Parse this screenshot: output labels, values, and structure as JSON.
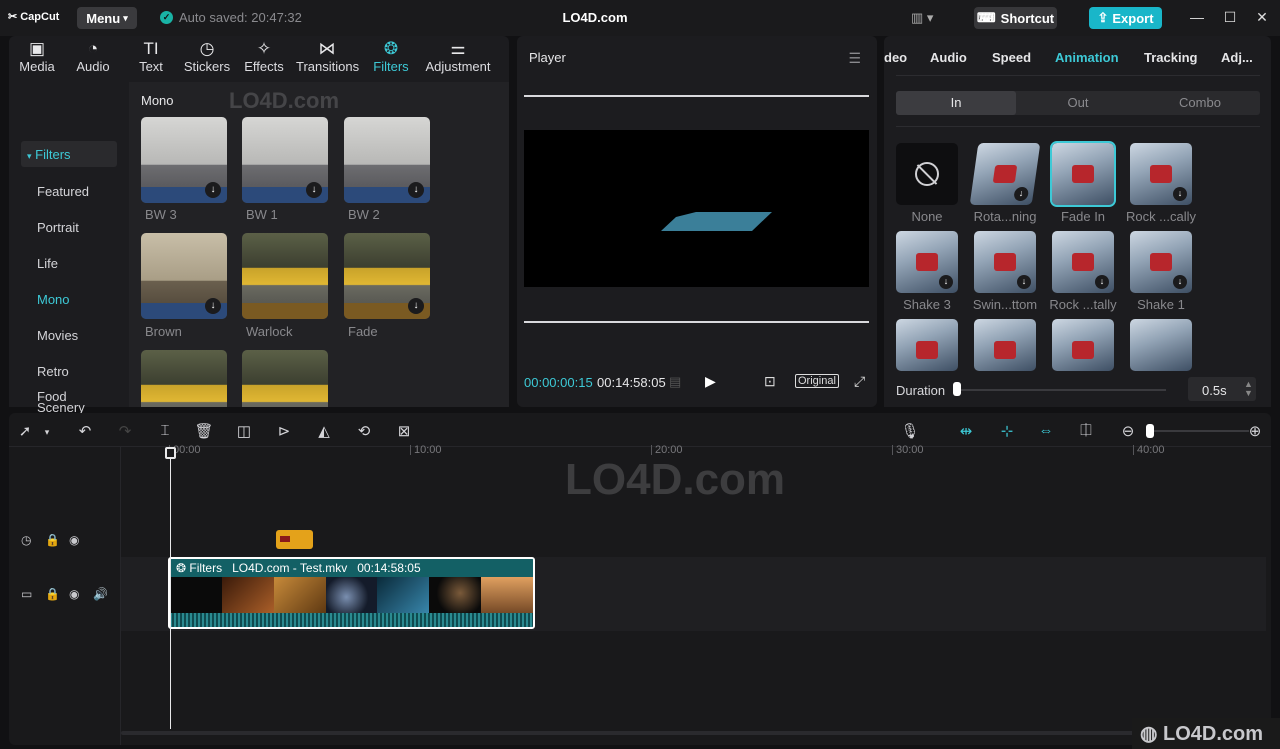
{
  "app": {
    "logo": "CapCut",
    "menu": "Menu",
    "autosave": "Auto saved: 20:47:32",
    "title": "LO4D.com",
    "shortcut": "Shortcut",
    "export": "Export"
  },
  "toptabs": [
    {
      "label": "Media"
    },
    {
      "label": "Audio"
    },
    {
      "label": "Text"
    },
    {
      "label": "Stickers"
    },
    {
      "label": "Effects"
    },
    {
      "label": "Transitions"
    },
    {
      "label": "Filters"
    },
    {
      "label": "Adjustment"
    }
  ],
  "filters": {
    "header": "Filters",
    "categories": [
      "Featured",
      "Portrait",
      "Life",
      "Mono",
      "Movies",
      "Retro",
      "Scenery",
      "Food"
    ],
    "section": "Mono",
    "items": [
      "BW 3",
      "BW 1",
      "BW 2",
      "Brown",
      "Warlock",
      "Fade"
    ]
  },
  "player": {
    "title": "Player",
    "current_time": "00:00:00:15",
    "duration": "00:14:58:05",
    "original": "Original"
  },
  "right": {
    "tabs": [
      "deo",
      "Audio",
      "Speed",
      "Animation",
      "Tracking",
      "Adj..."
    ],
    "segments": [
      "In",
      "Out",
      "Combo"
    ],
    "animations": [
      "None",
      "Rota...ning",
      "Fade In",
      "Rock ...cally",
      "Shake 3",
      "Swin...ttom",
      "Rock ...tally",
      "Shake 1"
    ],
    "duration_label": "Duration",
    "duration_value": "0.5s"
  },
  "timeline": {
    "ruler": [
      "00:00",
      "10:00",
      "20:00",
      "30:00",
      "40:00"
    ],
    "clip": {
      "effect": "Filters",
      "name": "LO4D.com - Test.mkv",
      "duration": "00:14:58:05"
    }
  },
  "watermark": {
    "text": "LO4D.com"
  },
  "colors": {
    "accent": "#3dc9d6",
    "export": "#19b6c9",
    "clip": "#0f4a4f",
    "marker": "#e4a21a"
  }
}
